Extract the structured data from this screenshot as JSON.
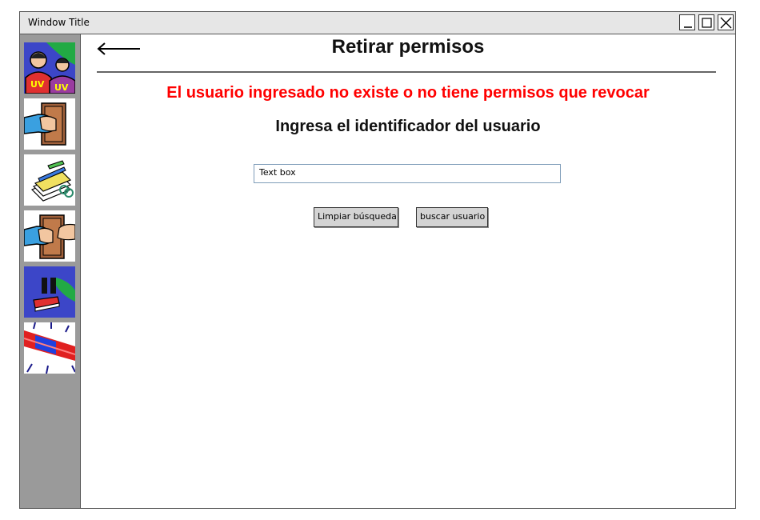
{
  "window": {
    "title": "Window Title",
    "controls": [
      "minimize-icon",
      "maximize-icon",
      "close-icon"
    ]
  },
  "sidebar": {
    "items": [
      {
        "name": "users",
        "icon": "users-icon"
      },
      {
        "name": "grant",
        "icon": "hand-book-icon"
      },
      {
        "name": "documents",
        "icon": "papers-pencil-icon"
      },
      {
        "name": "revoke",
        "icon": "hands-book-icon"
      },
      {
        "name": "suspend",
        "icon": "pause-book-icon"
      },
      {
        "name": "alert",
        "icon": "siren-icon"
      }
    ]
  },
  "header": {
    "back_icon": "back-arrow-icon",
    "title": "Retirar permisos"
  },
  "main": {
    "error_message": "El usuario ingresado no existe o no tiene permisos que revocar",
    "prompt": "Ingresa el identificador del usuario",
    "user_id_input": {
      "value": "Text box"
    },
    "clear_button_label": "Limpiar búsqueda",
    "search_button_label": "buscar usuario"
  },
  "colors": {
    "error": "#ff0000",
    "sidebar": "#9a9a9a",
    "titlebar": "#e6e6e6"
  }
}
